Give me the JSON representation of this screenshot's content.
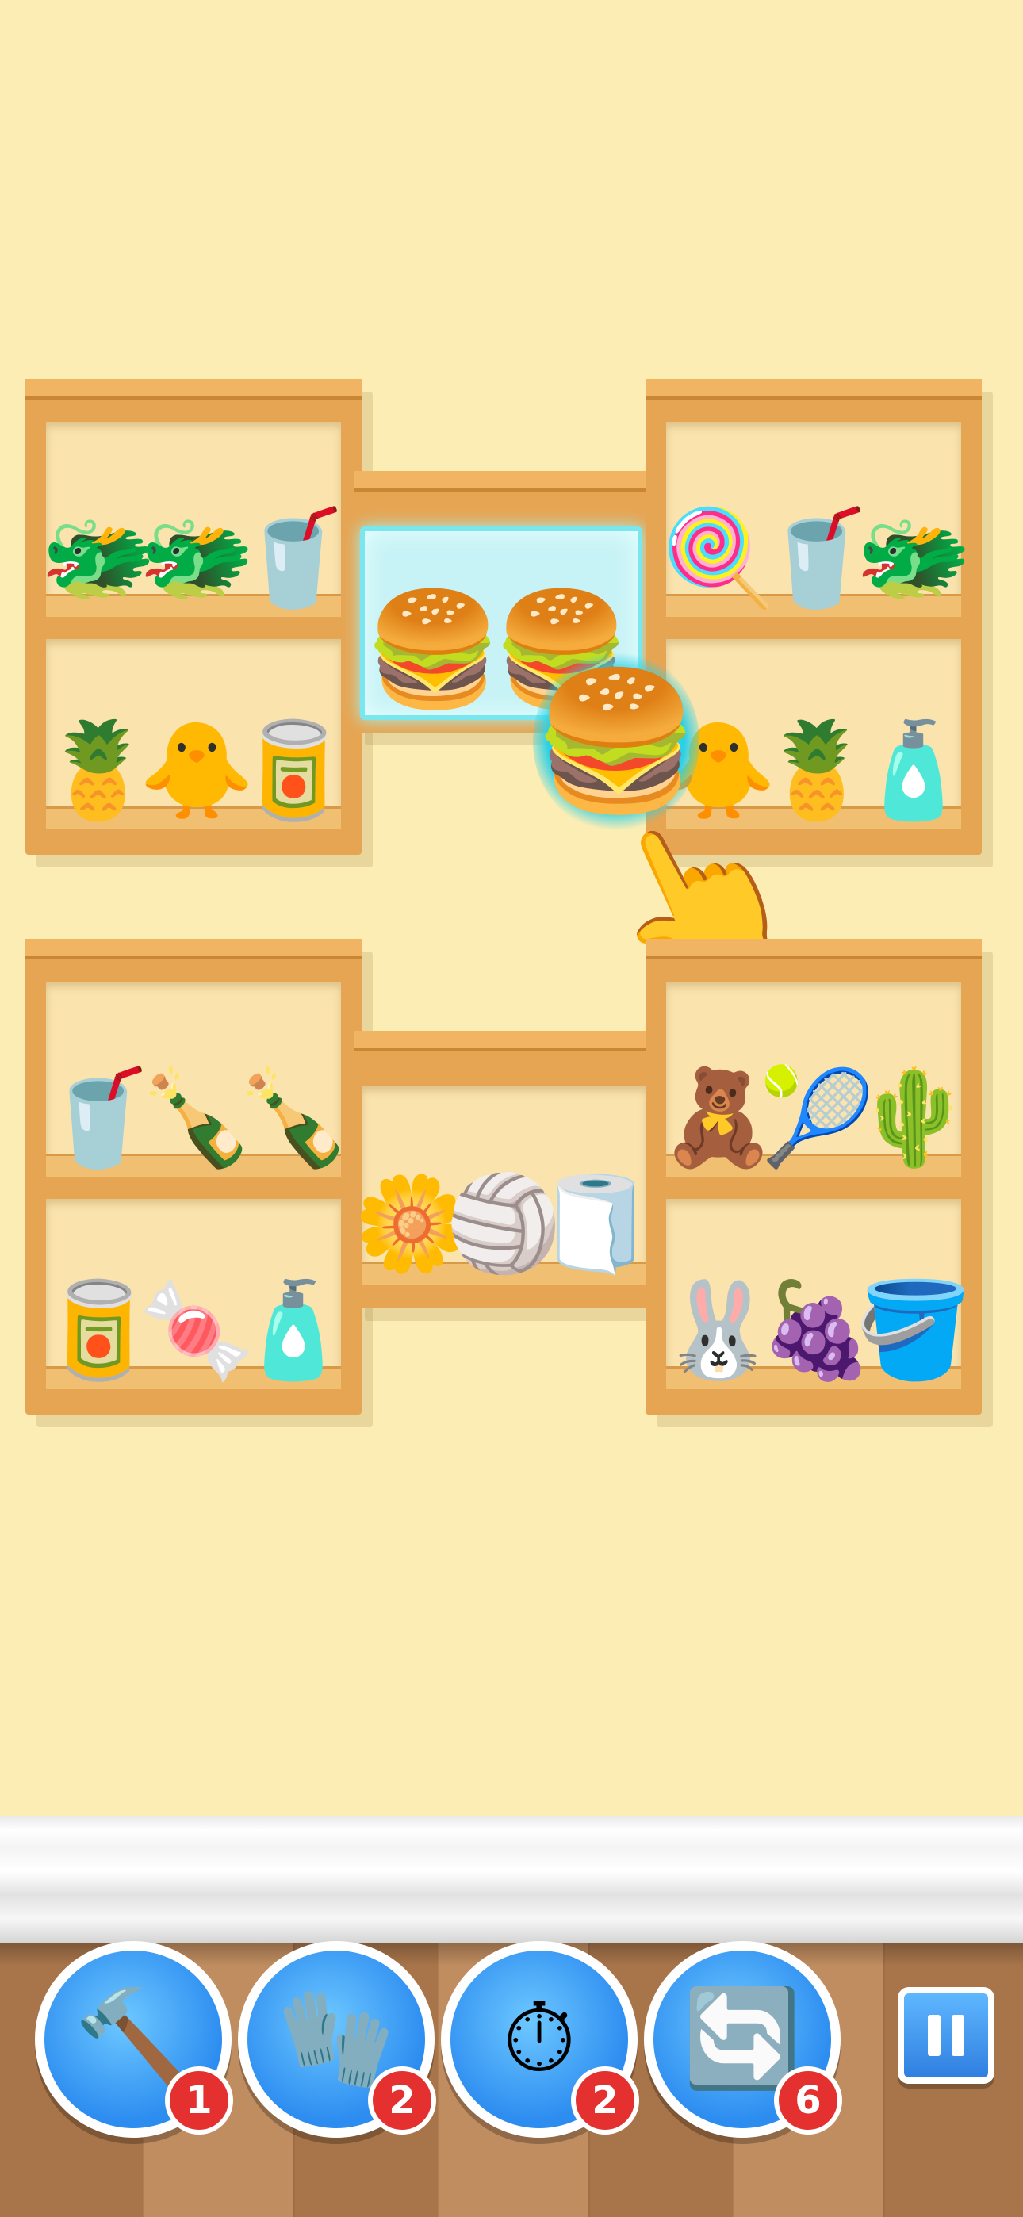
{
  "top_left_shelf": {
    "upper": [
      "🐲",
      "🐲",
      "🥤"
    ],
    "lower": [
      "🍍",
      "🐥",
      "🥫"
    ]
  },
  "top_middle_slot": {
    "items": [
      "🍔",
      "🍔"
    ],
    "highlighted": true
  },
  "top_right_shelf": {
    "upper": [
      "🍭",
      "🥤",
      "🐲"
    ],
    "lower": [
      "🐥",
      "🍍",
      "🧴"
    ]
  },
  "held_item": "🍔",
  "hand_icon": "👆",
  "bottom_left_shelf": {
    "upper": [
      "🥤",
      "🍾",
      "🍾"
    ],
    "lower": [
      "🥫",
      "🍬",
      "🧴"
    ]
  },
  "bottom_middle_shelf": {
    "items": [
      "🌼",
      "🏐",
      "🧻"
    ]
  },
  "bottom_right_shelf": {
    "upper": [
      "🧸",
      "🎾",
      "🌵"
    ],
    "lower": [
      "🐰",
      "🍇",
      "🪣"
    ]
  },
  "boosters": [
    {
      "name": "hammer",
      "icon": "🔨",
      "count": "1"
    },
    {
      "name": "glove",
      "icon": "🧤",
      "count": "2"
    },
    {
      "name": "freeze",
      "icon": "⏱",
      "count": "2"
    },
    {
      "name": "shuffle",
      "icon": "🔄",
      "count": "6"
    }
  ],
  "colors": {
    "wall": "#fbedb4",
    "shelf": "#e6a553",
    "glow": "#7ae6ee",
    "badge": "#e53030",
    "button": "#2c8cf0"
  }
}
